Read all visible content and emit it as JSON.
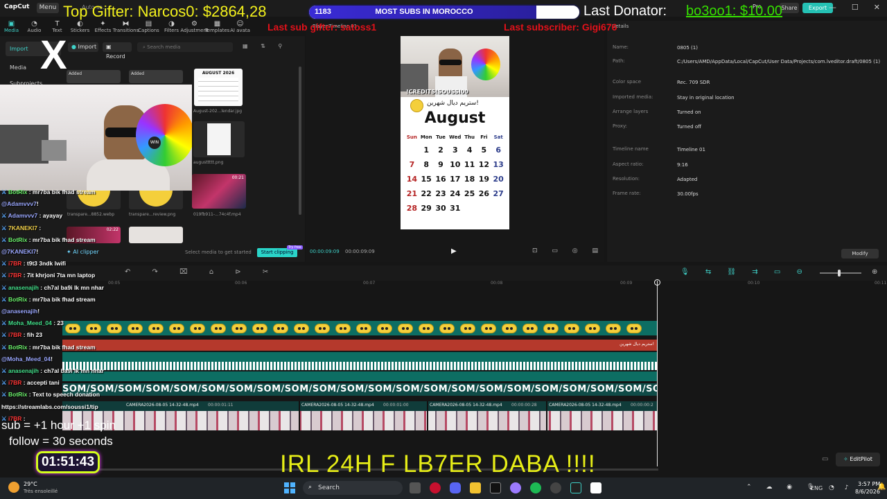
{
  "titlebar": {
    "app_name": "CapCut",
    "menu_label": "Menu",
    "autosave": "Auto sa...",
    "pro_label": "Pro",
    "share_label": "Share",
    "export_label": "Export"
  },
  "toolbar": {
    "tools": [
      {
        "label": "Media",
        "icon": "media-icon",
        "active": true
      },
      {
        "label": "Audio",
        "icon": "audio-icon",
        "active": false
      },
      {
        "label": "Text",
        "icon": "text-icon",
        "active": false
      },
      {
        "label": "Stickers",
        "icon": "stickers-icon",
        "active": false
      },
      {
        "label": "Effects",
        "icon": "effects-icon",
        "active": false
      },
      {
        "label": "Transitions",
        "icon": "transitions-icon",
        "active": false
      },
      {
        "label": "Captions",
        "icon": "captions-icon",
        "active": false
      },
      {
        "label": "Filters",
        "icon": "filters-icon",
        "active": false
      },
      {
        "label": "Adjustment",
        "icon": "adjustment-icon",
        "active": false
      },
      {
        "label": "Templates",
        "icon": "templates-icon",
        "active": false
      },
      {
        "label": "AI avata",
        "icon": "ai-avatar-icon",
        "active": false
      }
    ]
  },
  "media": {
    "left_items": [
      "Import",
      "Media",
      "Subprojects"
    ],
    "import_label": "Import",
    "record_label": "Record",
    "search_placeholder": "Search media",
    "added_label": "Added",
    "thumbs": [
      {
        "caption": "August-202...lendar.jpg",
        "title": "AUGUST 2026"
      },
      {
        "caption": "augusttttt.png"
      },
      {
        "caption": "transpare...8852.webp"
      },
      {
        "caption": "transpare...review.png"
      },
      {
        "caption": "019fb911-...74c4f.mp4",
        "duration": "00:21"
      },
      {
        "caption": "",
        "duration": "02:22"
      }
    ],
    "ai_clipper": "AI clipper",
    "footer_hint": "Select media to get started",
    "start_clipping": "Start clipping",
    "try_free": "Try free"
  },
  "player": {
    "title": "Player-Timeline 01",
    "timecode_current": "00:00:09:09",
    "timecode_total": "00:00:09:09"
  },
  "calendar": {
    "month": "August",
    "arabic_caption": "ستريم ديال شهرين!",
    "weekdays": [
      "Sun",
      "Mon",
      "Tue",
      "Wed",
      "Thu",
      "Fri",
      "Sat"
    ],
    "weeks": [
      [
        "",
        "1",
        "2",
        "3",
        "4",
        "5",
        "6"
      ],
      [
        "7",
        "8",
        "9",
        "10",
        "11",
        "12",
        "13"
      ],
      [
        "14",
        "15",
        "16",
        "17",
        "18",
        "19",
        "20"
      ],
      [
        "21",
        "22",
        "23",
        "24",
        "25",
        "26",
        "27"
      ],
      [
        "28",
        "29",
        "30",
        "31",
        "",
        "",
        ""
      ]
    ],
    "photo_caption": "!CREDITS!SOUSSI00"
  },
  "details": {
    "title": "Details",
    "rows": [
      {
        "label": "Name:",
        "value": "0805 (1)"
      },
      {
        "label": "Path:",
        "value": "C:/Users/AMD/AppData/Local/CapCut/User Data/Projects/com.lveditor.draft/0805 (1)"
      },
      {
        "label": "Color space",
        "value": "Rec. 709 SDR"
      },
      {
        "label": "Imported media:",
        "value": "Stay in original location"
      },
      {
        "label": "Arrange layers",
        "value": "Turned on"
      },
      {
        "label": "Proxy:",
        "value": "Turned off"
      },
      {
        "label": "Timeline name",
        "value": "Timeline 01"
      },
      {
        "label": "Aspect ratio:",
        "value": "9:16"
      },
      {
        "label": "Resolution:",
        "value": "Adapted"
      },
      {
        "label": "Frame rate:",
        "value": "30.00fps"
      }
    ],
    "modify_label": "Modify"
  },
  "timeline": {
    "ruler_ticks": [
      "00:05",
      "00:06",
      "00:07",
      "00:08",
      "00:09",
      "00:10",
      "00:11"
    ],
    "red_clip_label": "ستريم ديال شهرين!",
    "som_text": "SOM/SOM/SOM/SOM/SOM/SOM/SOM/SOM/SOM/SOM/SOM/SOM/SOM/SOM/SOM/SOM/SOM/SOM/SOM/SOM/SOM/SOM/SOM/S",
    "video_clips": [
      {
        "name": "CAMERA2026-08-05 14-32-48.mp4",
        "duration": "00:00:01:11"
      },
      {
        "name": "CAMERA2026-08-05 14-32-48.mp4",
        "duration": "00:00:01:00"
      },
      {
        "name": "CAMERA2026-08-05 14-32-48.mp4",
        "duration": "00:00:00:28"
      },
      {
        "name": "CAMERA2026-08-05 14-32-48.mp4",
        "duration": "00:00:00:2"
      }
    ],
    "editpilot_label": "EditPilot"
  },
  "overlay": {
    "top_gifter": "Top Gifter: Narcos0: $2864,28",
    "subs_count": "1183",
    "subs_goal_label": "MOST SUBS IN MOROCCO",
    "subs_progress": 0.84,
    "last_donator_label": "Last Donator:",
    "last_donator_name": "bo3oo1: $10.00",
    "last_sub_gifter": "Last sub gifter: satoss1",
    "last_subscriber": "Last subscriber: Gigi676",
    "x_logo": "X",
    "sub_rule": "sub  = +1 hour +1 spin",
    "follow_rule": "follow = 30 seconds",
    "timer": "01:51:43",
    "banner": "IRL 24H F LB7ER DABA !!!!"
  },
  "chat": [
    {
      "name": "BotRix",
      "name_class": "n-bot",
      "msg": " : mr7ba bik fhad stream"
    },
    {
      "name": "@Adamvvv7",
      "name_class": "n-b",
      "msg": "!"
    },
    {
      "name": "Adamvvv7",
      "name_class": "n-b",
      "msg": " : ayayay"
    },
    {
      "name": "7KANEKI7",
      "name_class": "n-y",
      "msg": " : "
    },
    {
      "name": "BotRix",
      "name_class": "n-bot",
      "msg": " : mr7ba bik fhad stream"
    },
    {
      "name": "@7KANEKI7",
      "name_class": "n-b",
      "msg": "!"
    },
    {
      "name": "i7BR",
      "name_class": "n-r",
      "msg": " : t9t3 3ndk lwifi"
    },
    {
      "name": "i7BR",
      "name_class": "n-r",
      "msg": " : 7it khrjoni 7ta mn laptop"
    },
    {
      "name": "anasenajih",
      "name_class": "n-g",
      "msg": " : ch7al ba9i lk mn nhar"
    },
    {
      "name": "BotRix",
      "name_class": "n-bot",
      "msg": " : mr7ba bik fhad stream"
    },
    {
      "name": "@anasenajih",
      "name_class": "n-b",
      "msg": "!"
    },
    {
      "name": "Moha_Meed_04",
      "name_class": "n-g",
      "msg": " : 23"
    },
    {
      "name": "i7BR",
      "name_class": "n-r",
      "msg": " : fih 23"
    },
    {
      "name": "BotRix",
      "name_class": "n-bot",
      "msg": " : mr7ba bik fhad stream"
    },
    {
      "name": "@Moha_Meed_04",
      "name_class": "n-b",
      "msg": "!"
    },
    {
      "name": "anasenajih",
      "name_class": "n-g",
      "msg": " : ch7al ba9i lk mn nhar"
    },
    {
      "name": "i7BR",
      "name_class": "n-r",
      "msg": " : accepti tani"
    },
    {
      "name": "BotRix",
      "name_class": "n-bot",
      "msg": " : Text to speech donation"
    },
    {
      "name": "",
      "name_class": "n-b",
      "msg": "https://streamlabs.com/soussi1/tip"
    },
    {
      "name": "i7BR",
      "name_class": "n-r",
      "msg": " : "
    }
  ],
  "taskbar": {
    "temp": "29°C",
    "weather": "Très ensoleillé",
    "search_label": "Search",
    "lang": "ENG",
    "time": "3:57 PM",
    "date": "8/6/2026"
  },
  "colors": {
    "accent": "#3fd1c8",
    "gifter_yellow": "#f3f11c",
    "subscriber_red": "#e3111a",
    "donator_green": "#36e000",
    "banner_yellow": "#e6ed17"
  }
}
